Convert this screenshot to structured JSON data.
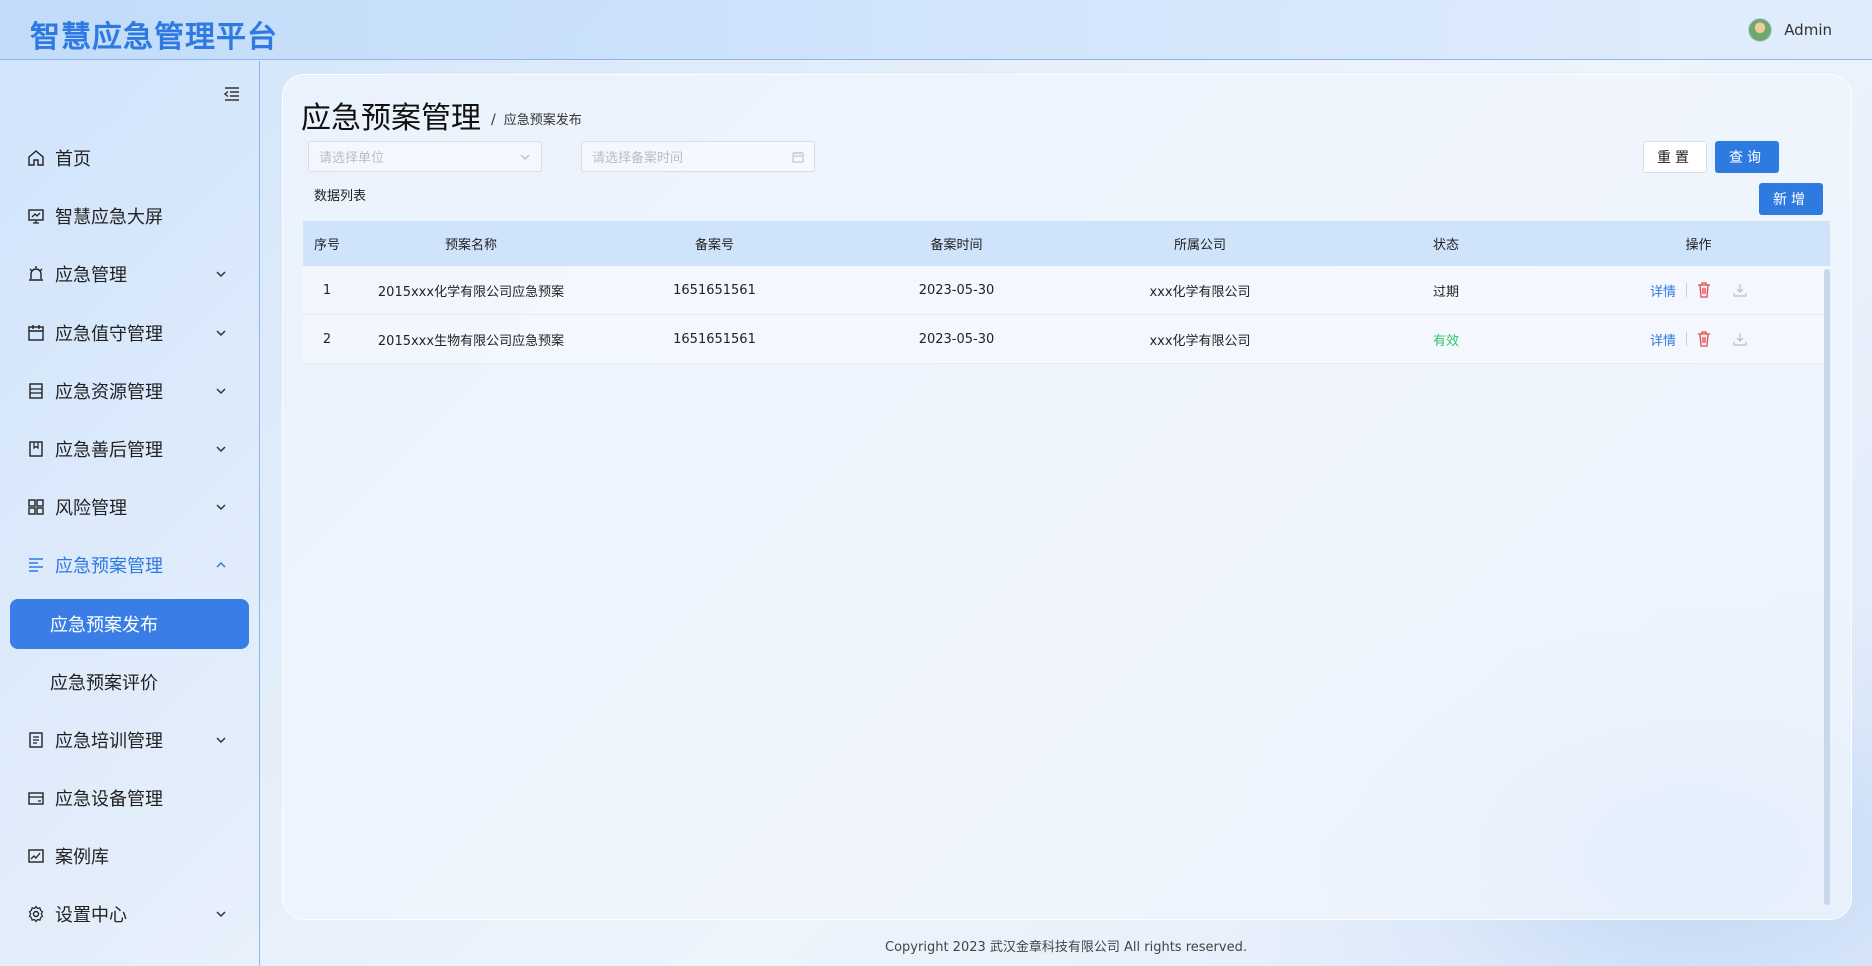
{
  "header": {
    "app_title": "智慧应急管理平台",
    "user_name": "Admin"
  },
  "sidebar": {
    "items": [
      {
        "label": "首页",
        "icon": "home-icon"
      },
      {
        "label": "智慧应急大屏",
        "icon": "monitor-icon"
      },
      {
        "label": "应急管理",
        "icon": "alarm-icon",
        "expandable": true
      },
      {
        "label": "应急值守管理",
        "icon": "calendar-icon",
        "expandable": true
      },
      {
        "label": "应急资源管理",
        "icon": "document-icon",
        "expandable": true
      },
      {
        "label": "应急善后管理",
        "icon": "notebook-icon",
        "expandable": true
      },
      {
        "label": "风险管理",
        "icon": "grid-icon",
        "expandable": true
      },
      {
        "label": "应急预案管理",
        "icon": "list-icon",
        "expandable": true,
        "open": true
      },
      {
        "label": "应急培训管理",
        "icon": "clipboard-icon",
        "expandable": true
      },
      {
        "label": "应急设备管理",
        "icon": "card-icon"
      },
      {
        "label": "案例库",
        "icon": "chart-icon"
      },
      {
        "label": "设置中心",
        "icon": "gear-icon",
        "expandable": true
      }
    ],
    "sub_items": [
      {
        "label": "应急预案发布",
        "active": true
      },
      {
        "label": "应急预案评价",
        "active": false
      }
    ]
  },
  "main": {
    "page_title": "应急预案管理",
    "breadcrumb_sep": "/",
    "breadcrumb": "应急预案发布",
    "filters": {
      "unit_placeholder": "请选择单位",
      "time_placeholder": "请选择备案时间"
    },
    "buttons": {
      "reset": "重置",
      "query": "查询",
      "add": "新增"
    },
    "list_label": "数据列表",
    "table": {
      "headers": [
        "序号",
        "预案名称",
        "备案号",
        "备案时间",
        "所属公司",
        "状态",
        "操作"
      ],
      "rows": [
        {
          "index": "1",
          "name": "2015xxx化学有限公司应急预案",
          "record_no": "1651651561",
          "record_time": "2023-05-30",
          "company": "xxx化学有限公司",
          "status": "过期",
          "status_color": "#222222",
          "detail": "详情"
        },
        {
          "index": "2",
          "name": "2015xxx生物有限公司应急预案",
          "record_no": "1651651561",
          "record_time": "2023-05-30",
          "company": "xxx化学有限公司",
          "status": "有效",
          "status_color": "#2ec76b",
          "detail": "详情"
        }
      ]
    }
  },
  "footer": {
    "copyright": "Copyright 2023 武汉金章科技有限公司 All rights reserved."
  },
  "colors": {
    "accent": "#2f7ae0",
    "valid": "#2ec76b",
    "delete": "#e0474c"
  }
}
